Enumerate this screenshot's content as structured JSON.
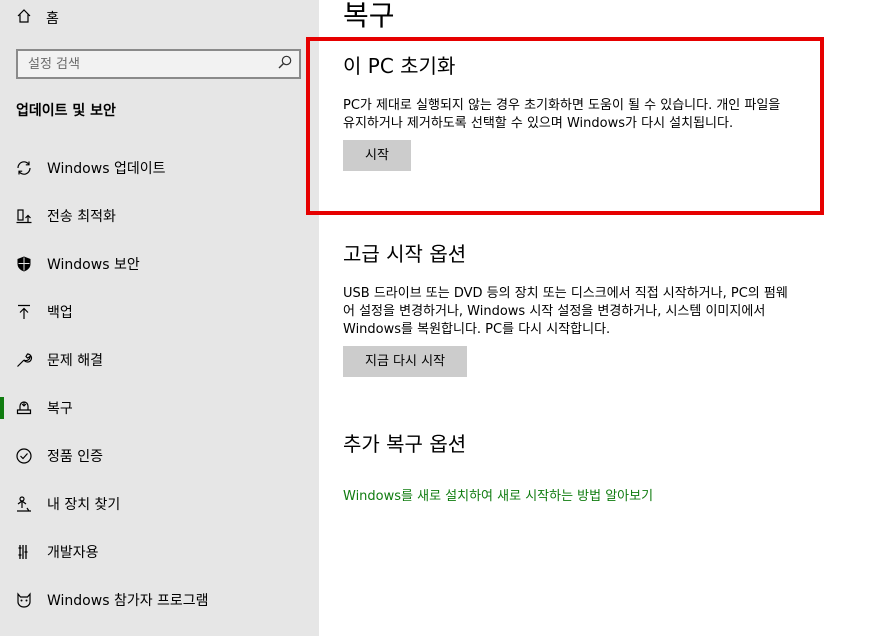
{
  "sidebar": {
    "home_label": "홈",
    "search_placeholder": "설정 검색",
    "section_heading": "업데이트 및 보안",
    "items": [
      {
        "label": "Windows 업데이트",
        "icon": "refresh-icon"
      },
      {
        "label": "전송 최적화",
        "icon": "delivery-optimization-icon"
      },
      {
        "label": "Windows 보안",
        "icon": "shield-icon"
      },
      {
        "label": "백업",
        "icon": "backup-arrow-icon"
      },
      {
        "label": "문제 해결",
        "icon": "wrench-icon"
      },
      {
        "label": "복구",
        "icon": "recovery-icon",
        "selected": true
      },
      {
        "label": "정품 인증",
        "icon": "check-circle-icon"
      },
      {
        "label": "내 장치 찾기",
        "icon": "find-device-icon"
      },
      {
        "label": "개발자용",
        "icon": "developer-icon"
      },
      {
        "label": "Windows 참가자 프로그램",
        "icon": "insider-cat-icon"
      }
    ]
  },
  "main": {
    "title": "복구",
    "reset": {
      "heading": "이 PC 초기화",
      "description": "PC가 제대로 실행되지 않는 경우 초기화하면 도움이 될 수 있습니다. 개인 파일을 유지하거나 제거하도록 선택할 수 있으며 Windows가 다시 설치됩니다.",
      "button": "시작"
    },
    "advanced": {
      "heading": "고급 시작 옵션",
      "description": "USB 드라이브 또는 DVD 등의 장치 또는 디스크에서 직접 시작하거나, PC의 펌웨어 설정을 변경하거나, Windows 시작 설정을 변경하거나, 시스템 이미지에서 Windows를 복원합니다. PC를 다시 시작합니다.",
      "button": "지금 다시 시작"
    },
    "more": {
      "heading": "추가 복구 옵션",
      "link": "Windows를 새로 설치하여 새로 시작하는 방법 알아보기"
    }
  },
  "colors": {
    "accent": "#107c10",
    "highlight": "#e60000",
    "sidebar_bg": "#e6e6e6",
    "button_bg": "#cccccc"
  }
}
